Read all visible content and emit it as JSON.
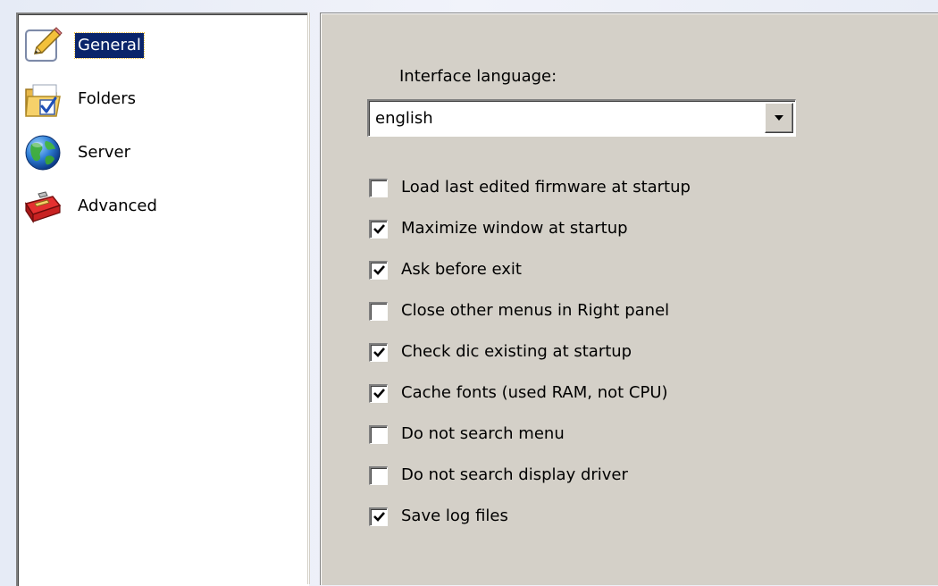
{
  "nav": {
    "items": [
      {
        "label": "General",
        "icon": "pencil-note-icon",
        "selected": true
      },
      {
        "label": "Folders",
        "icon": "folder-check-icon",
        "selected": false
      },
      {
        "label": "Server",
        "icon": "globe-icon",
        "selected": false
      },
      {
        "label": "Advanced",
        "icon": "red-toolbox-icon",
        "selected": false
      }
    ]
  },
  "general": {
    "language_label": "Interface language:",
    "language_value": "english",
    "options": [
      {
        "label": "Load last edited firmware at startup",
        "checked": false
      },
      {
        "label": "Maximize window at startup",
        "checked": true
      },
      {
        "label": "Ask before exit",
        "checked": true
      },
      {
        "label": "Close other menus in Right panel",
        "checked": false
      },
      {
        "label": "Check dic existing at startup",
        "checked": true
      },
      {
        "label": "Cache fonts (used RAM, not CPU)",
        "checked": true
      },
      {
        "label": "Do not search menu",
        "checked": false
      },
      {
        "label": "Do not search display driver",
        "checked": false
      },
      {
        "label": "Save log files",
        "checked": true
      }
    ]
  },
  "colors": {
    "selection_bg": "#0a246a",
    "panel_bg": "#d4d0c8",
    "list_bg": "#ffffff"
  }
}
